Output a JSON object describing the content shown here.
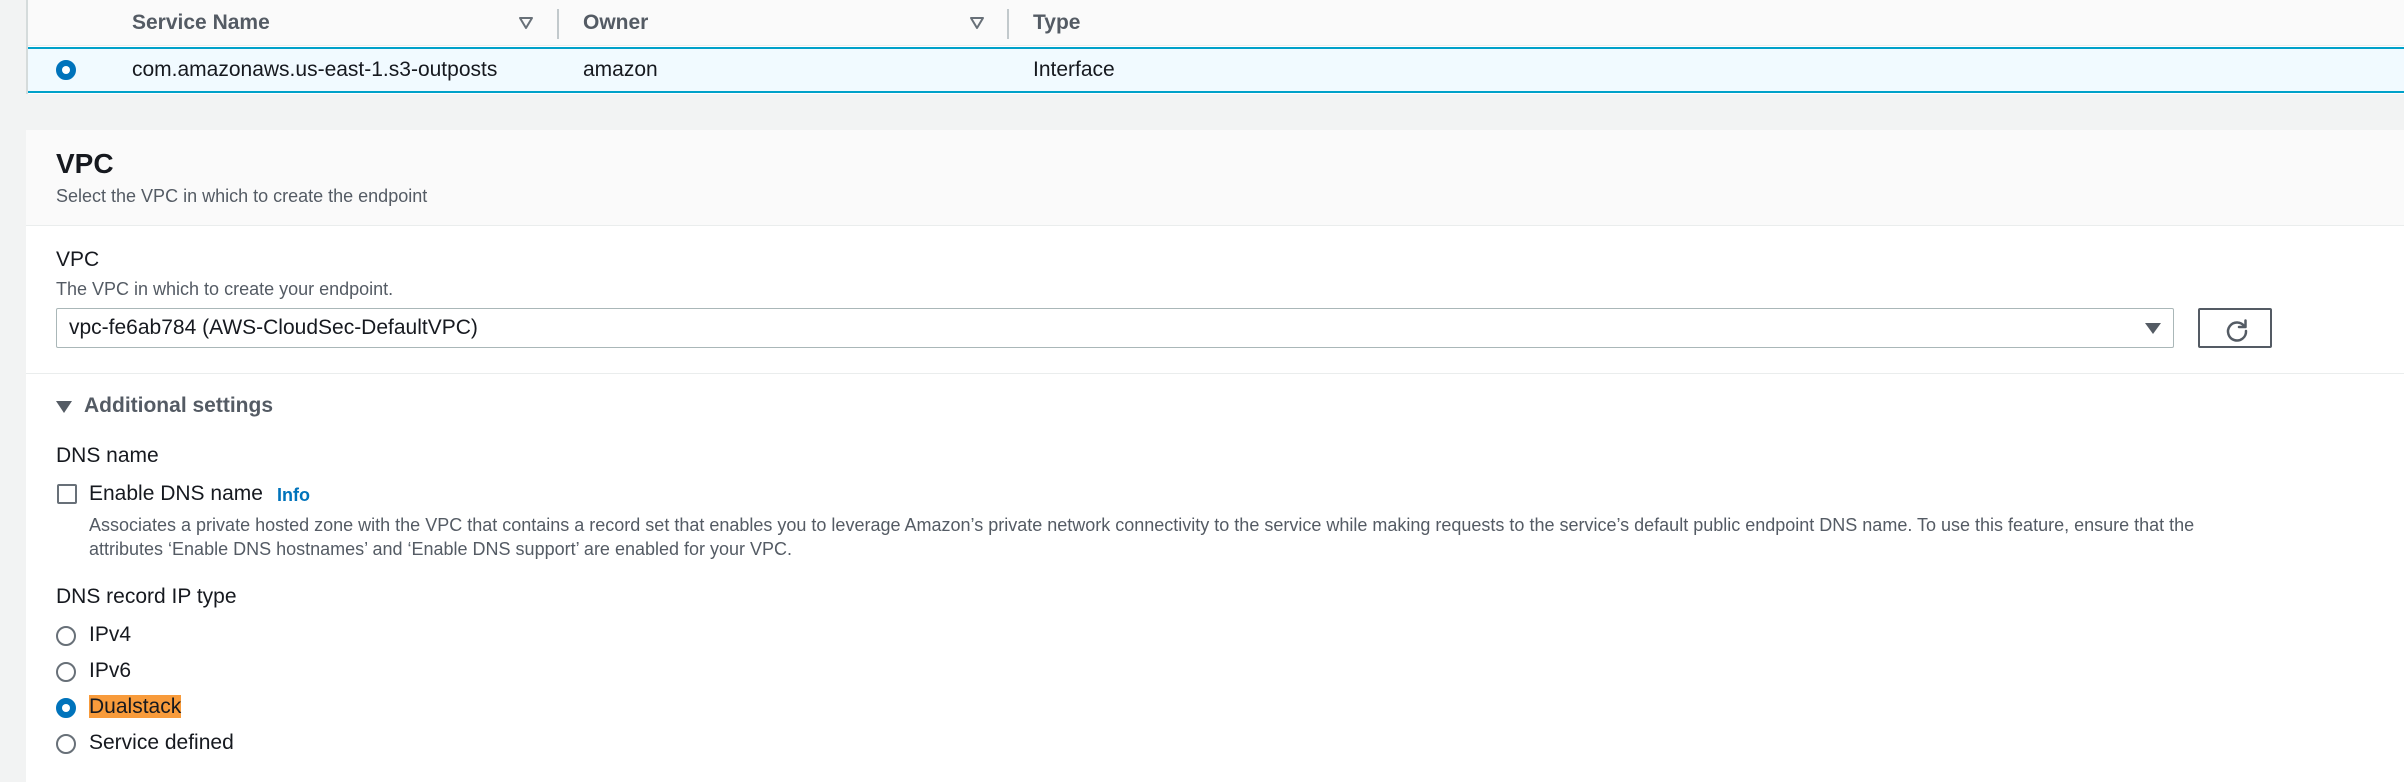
{
  "table": {
    "columns": [
      "Service Name",
      "Owner",
      "Type"
    ],
    "rows": [
      {
        "selected": true,
        "service_name": "com.amazonaws.us-east-1.s3-outposts",
        "owner": "amazon",
        "type": "Interface"
      }
    ]
  },
  "vpc_section": {
    "title": "VPC",
    "description": "Select the VPC in which to create the endpoint",
    "vpc_field": {
      "label": "VPC",
      "description": "The VPC in which to create your endpoint.",
      "value": "vpc-fe6ab784 (AWS-CloudSec-DefaultVPC)"
    },
    "additional_settings": {
      "label": "Additional settings",
      "expanded": true,
      "dns_name": {
        "label": "DNS name",
        "checkbox_label": "Enable DNS name",
        "checked": false,
        "info_link": "Info",
        "description": "Associates a private hosted zone with the VPC that contains a record set that enables you to leverage Amazon’s private network connectivity to the service while making requests to the service’s default public endpoint DNS name. To use this feature, ensure that the attributes ‘Enable DNS hostnames’ and ‘Enable DNS support’ are enabled for your VPC."
      },
      "dns_record_ip_type": {
        "label": "DNS record IP type",
        "options": [
          "IPv4",
          "IPv6",
          "Dualstack",
          "Service defined"
        ],
        "selected": "Dualstack"
      }
    }
  },
  "colors": {
    "accent": "#0073bb",
    "selected_row_border": "#00a1c9",
    "selected_row_bg": "#f1faff",
    "highlight": "#f89b3b"
  }
}
